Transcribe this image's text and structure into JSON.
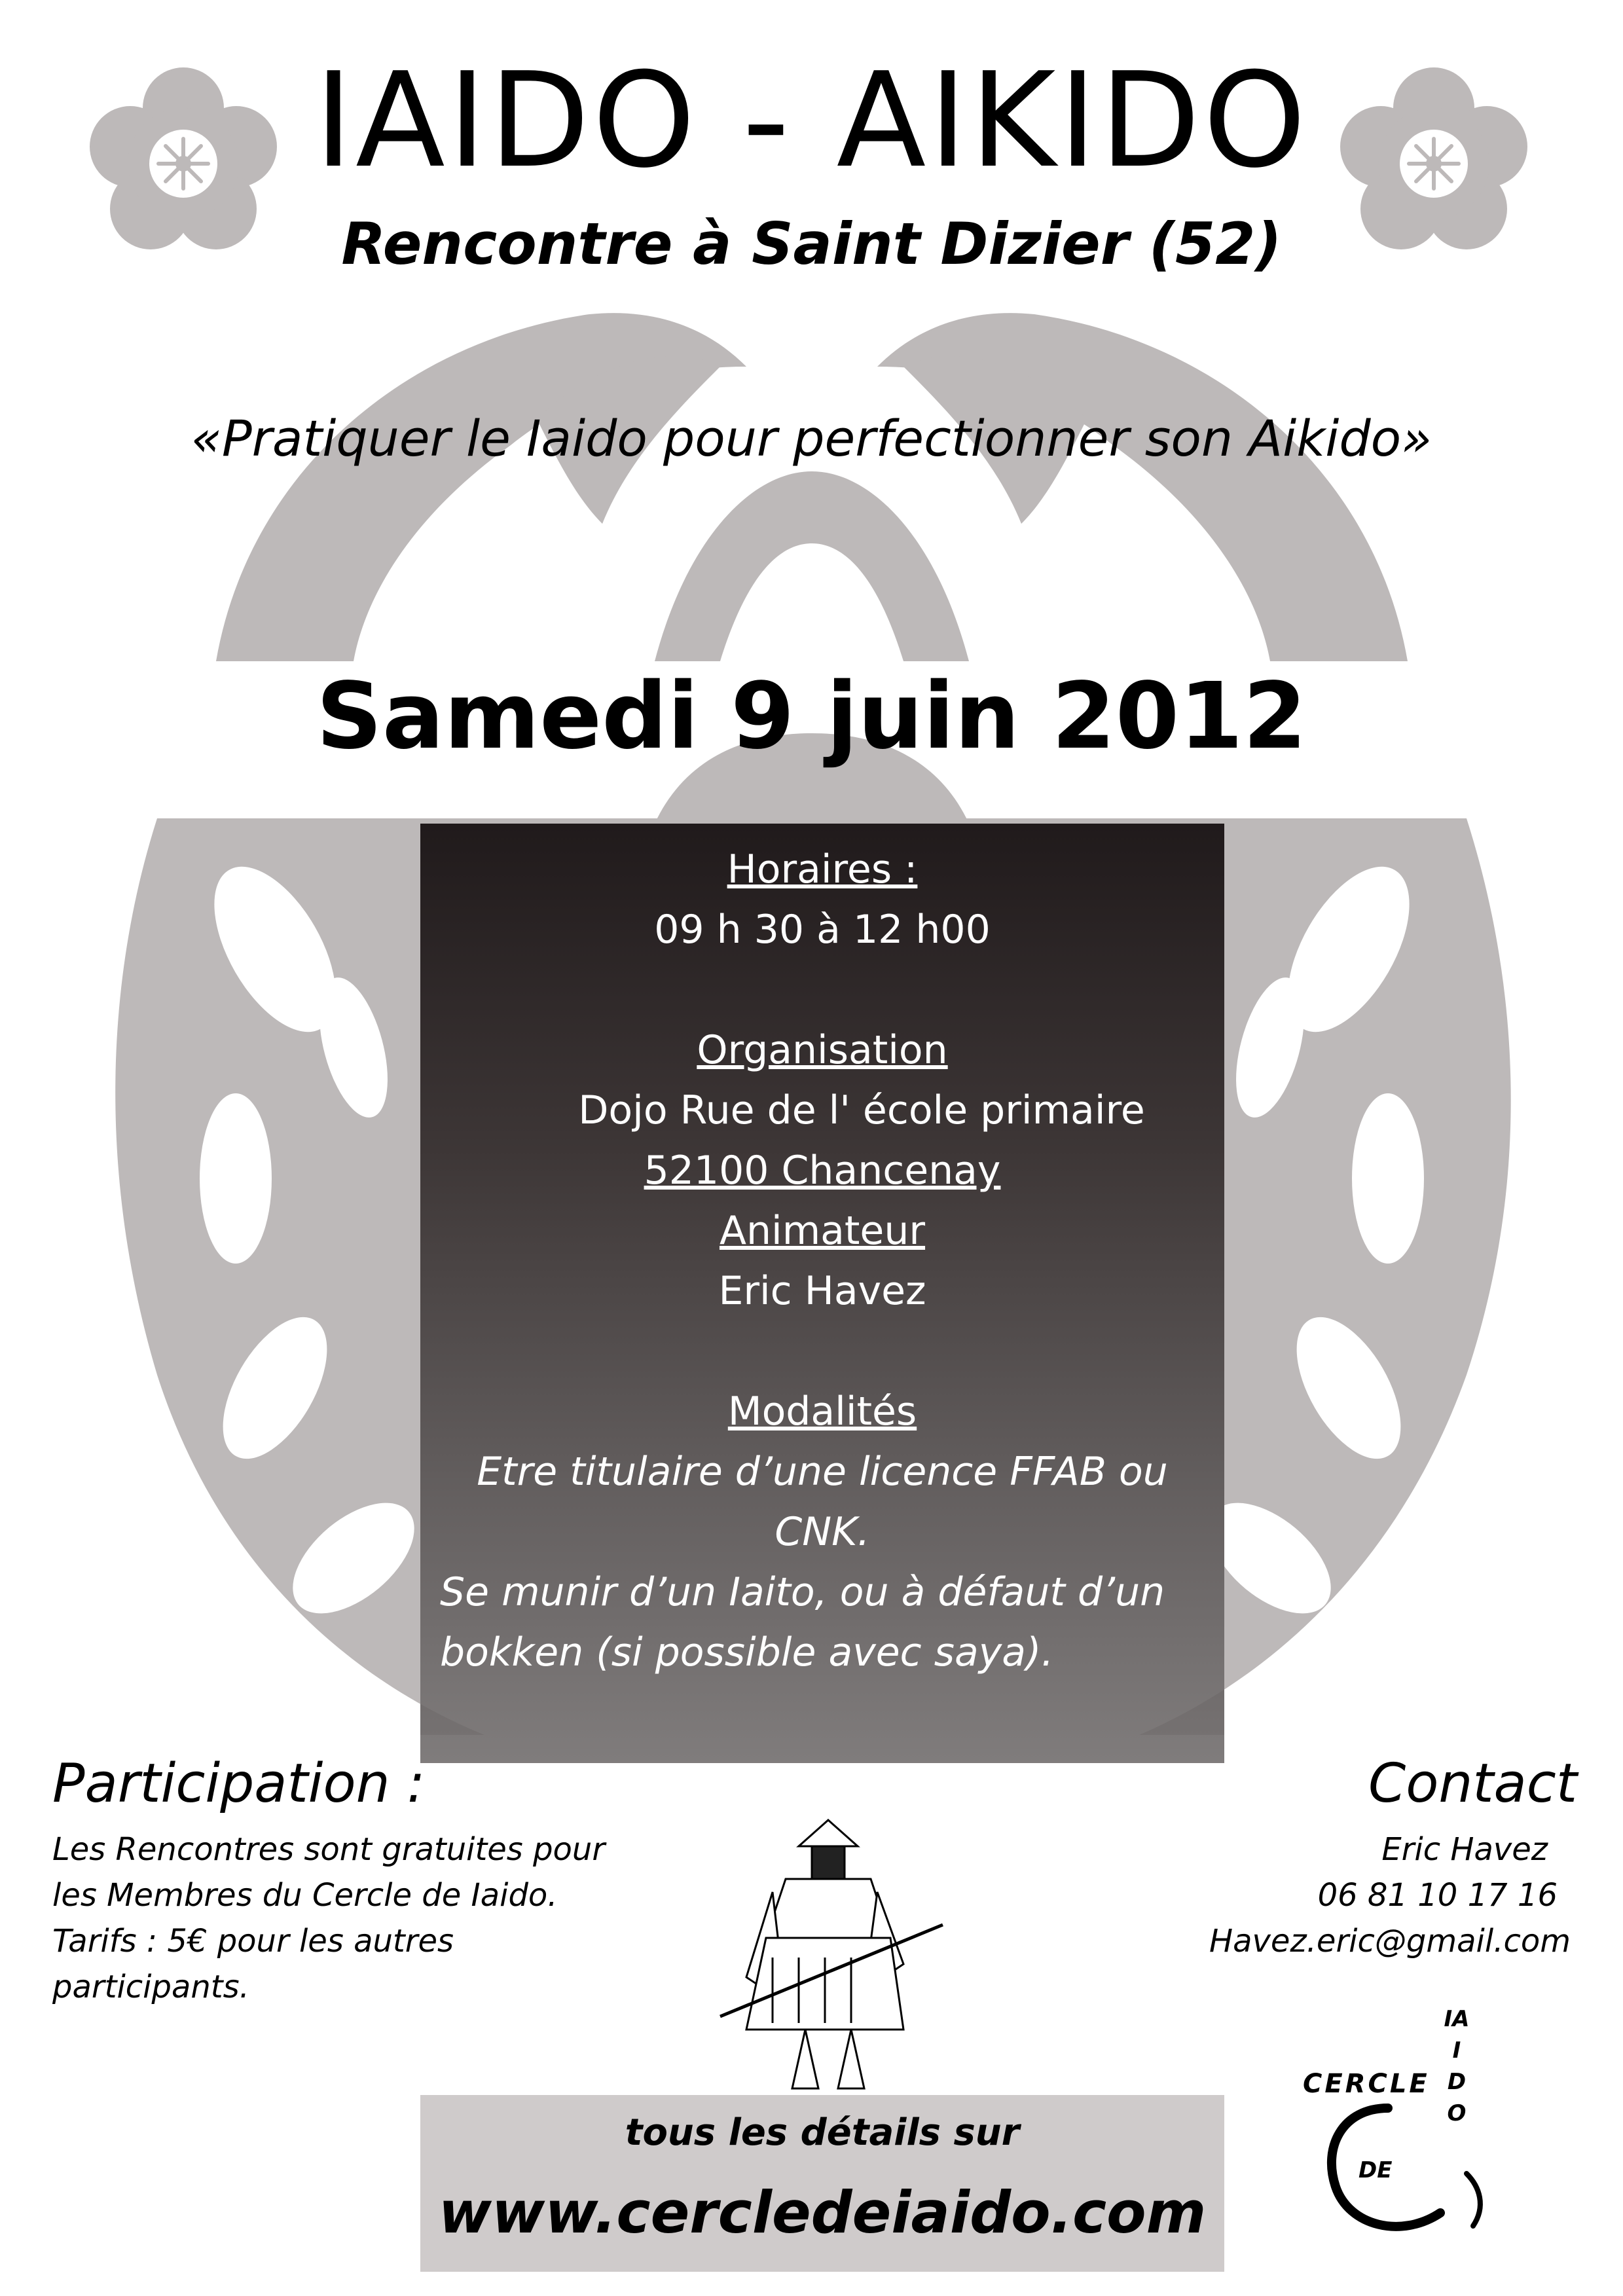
{
  "header": {
    "title": "IAIDO - AIKIDO",
    "subtitle": "Rencontre à Saint Dizier (52)",
    "quote": "«Pratiquer le Iaido pour perfectionner son Aikido»",
    "date": "Samedi 9 juin 2012"
  },
  "info": {
    "horaires_heading": "Horaires :",
    "horaires_value": "09 h 30 à 12 h00",
    "organisation_heading": "Organisation",
    "organisation_line1": "Dojo Rue de l' école primaire",
    "organisation_line2": "52100 Chancenay",
    "animateur_heading": "Animateur",
    "animateur_value": "Eric Havez",
    "modalites_heading": "Modalités",
    "modalites_line1": "Etre titulaire d’une licence FFAB ou",
    "modalites_line2": "CNK.",
    "modalites_line3": "Se munir d’un Iaito, ou à défaut d’un",
    "modalites_line4": "bokken (si possible avec saya)."
  },
  "participation": {
    "title": "Participation :",
    "lines": [
      "Les Rencontres sont gratuites pour",
      "les Membres du Cercle de Iaido.",
      "Tarifs : 5€ pour les autres",
      "participants."
    ]
  },
  "contact": {
    "title": "Contact",
    "name": "Eric Havez",
    "phone": "06 81 10 17 16",
    "email": "Havez.eric@gmail.com"
  },
  "footer": {
    "details_label": "tous les détails sur",
    "website": "www.cercledeiaido.com"
  },
  "logo": {
    "text_cercle": "CERCLE",
    "text_de": "DE",
    "text_iaido_vertical": "IAIDO"
  },
  "colors": {
    "crest_gray": "#bdb9b9",
    "panel_dark": "#201a1b",
    "details_box": "#cfcbcb"
  },
  "icons": [
    "sakura-mon-icon",
    "samurai-illustration",
    "cercle-de-iaido-logo"
  ]
}
